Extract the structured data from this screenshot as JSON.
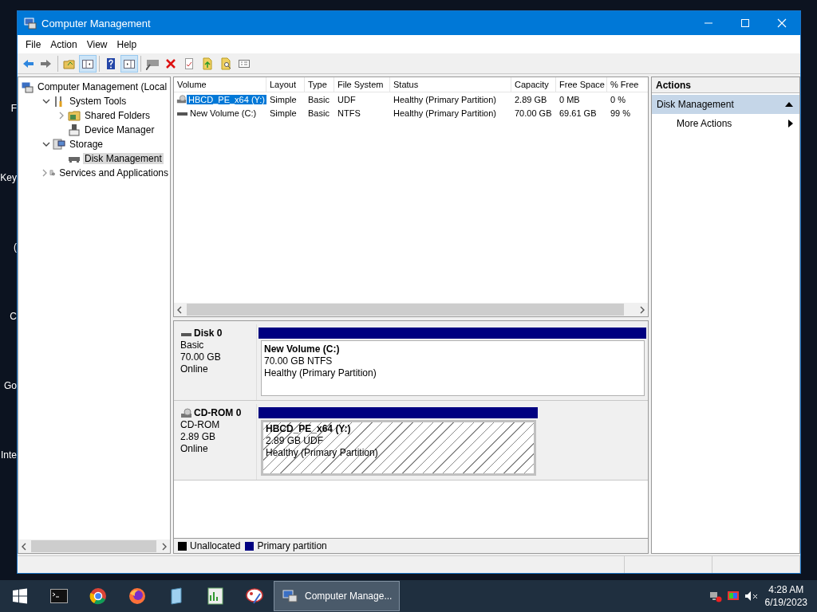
{
  "desktop_labels": [
    "F",
    "Key",
    "(",
    "C",
    "Go",
    "Inte"
  ],
  "window": {
    "title": "Computer Management"
  },
  "menu": [
    "File",
    "Action",
    "View",
    "Help"
  ],
  "toolbar": [
    {
      "kind": "back",
      "pressed": false
    },
    {
      "kind": "forward",
      "pressed": false
    },
    {
      "kind": "sep"
    },
    {
      "kind": "upfolder",
      "pressed": false
    },
    {
      "kind": "tree",
      "pressed": true
    },
    {
      "kind": "sep"
    },
    {
      "kind": "help",
      "pressed": false
    },
    {
      "kind": "actionpane",
      "pressed": true
    },
    {
      "kind": "sep"
    },
    {
      "kind": "connect",
      "pressed": false
    },
    {
      "kind": "delete",
      "pressed": false
    },
    {
      "kind": "properties",
      "pressed": false
    },
    {
      "kind": "export",
      "pressed": false
    },
    {
      "kind": "find",
      "pressed": false
    },
    {
      "kind": "list",
      "pressed": false
    }
  ],
  "tree": [
    {
      "label": "Computer Management (Local",
      "kind": "computer",
      "selected": false,
      "children": [
        {
          "label": "System Tools",
          "kind": "tools",
          "expanded": true,
          "selected": false,
          "children": [
            {
              "label": "Shared Folders",
              "kind": "folder",
              "expanded": false,
              "selected": false
            },
            {
              "label": "Device Manager",
              "kind": "device",
              "selected": false
            }
          ]
        },
        {
          "label": "Storage",
          "kind": "storage",
          "expanded": true,
          "selected": false,
          "children": [
            {
              "label": "Disk Management",
              "kind": "disk",
              "selected": true
            }
          ]
        },
        {
          "label": "Services and Applications",
          "kind": "services",
          "expanded": false,
          "selected": false
        }
      ]
    }
  ],
  "table": {
    "columns": [
      "Volume",
      "Layout",
      "Type",
      "File System",
      "Status",
      "Capacity",
      "Free Space",
      "% Free"
    ],
    "rows": [
      {
        "kind": "cdrom",
        "selected": true,
        "cells": [
          "HBCD_PE_x64 (Y:)",
          "Simple",
          "Basic",
          "UDF",
          "Healthy (Primary Partition)",
          "2.89 GB",
          "0 MB",
          "0 %"
        ]
      },
      {
        "kind": "disk",
        "selected": false,
        "cells": [
          "New Volume (C:)",
          "Simple",
          "Basic",
          "NTFS",
          "Healthy (Primary Partition)",
          "70.00 GB",
          "69.61 GB",
          "99 %"
        ]
      }
    ]
  },
  "disks": [
    {
      "kind": "disk",
      "name": "Disk 0",
      "lines": [
        "Basic",
        "70.00 GB",
        "Online"
      ],
      "partition": {
        "name": "New Volume  (C:)",
        "size": "70.00 GB NTFS",
        "status": "Healthy (Primary Partition)"
      }
    },
    {
      "kind": "cdrom",
      "name": "CD-ROM 0",
      "lines": [
        "CD-ROM",
        "2.89 GB",
        "Online"
      ],
      "partition": {
        "name": "HBCD_PE_x64  (Y:)",
        "size": "2.89 GB UDF",
        "status": "Healthy (Primary Partition)"
      }
    }
  ],
  "legend": [
    {
      "label": "Unallocated",
      "color": "#000000"
    },
    {
      "label": "Primary partition",
      "color": "#000080"
    }
  ],
  "actions": {
    "title": "Actions",
    "section": {
      "label": "Disk Management",
      "expanded": true
    },
    "items": [
      "More Actions"
    ]
  },
  "taskbar": {
    "active_window": "Computer Manage...",
    "time": "4:28 AM",
    "date": "6/19/2023"
  }
}
